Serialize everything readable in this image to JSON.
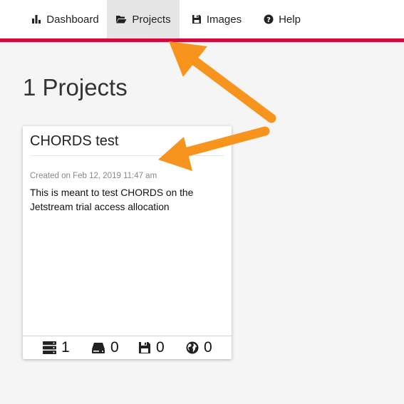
{
  "nav": {
    "items": [
      {
        "label": "Dashboard",
        "icon": "bar-chart-icon"
      },
      {
        "label": "Projects",
        "icon": "folder-open-icon"
      },
      {
        "label": "Images",
        "icon": "floppy-disk-icon"
      },
      {
        "label": "Help",
        "icon": "question-circle-icon"
      }
    ],
    "active": "Projects",
    "accent": "#d6083b"
  },
  "page": {
    "title": "1 Projects"
  },
  "project_card": {
    "title": "CHORDS test",
    "created": "Created on Feb 12, 2019 11:47 am",
    "description": "This is meant to test CHORDS on the Jetstream trial access allocation",
    "stats": [
      {
        "icon": "server-icon",
        "value": "1"
      },
      {
        "icon": "hard-drive-icon",
        "value": "0"
      },
      {
        "icon": "floppy-disk-icon",
        "value": "0"
      },
      {
        "icon": "globe-icon",
        "value": "0"
      }
    ]
  },
  "annotation": {
    "arrow_color": "#f7941d",
    "arrows": [
      "arrow-to-projects-tab",
      "arrow-to-created-date"
    ]
  }
}
